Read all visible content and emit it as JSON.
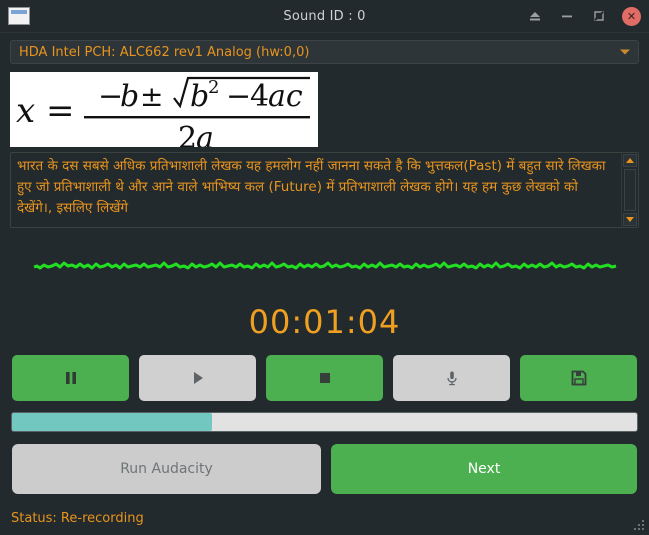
{
  "window": {
    "title": "Sound ID : 0",
    "app_icon": "window-icon",
    "buttons": [
      {
        "name": "shade-button",
        "icon": "eject-icon"
      },
      {
        "name": "minimize-button",
        "icon": "minimize-icon"
      },
      {
        "name": "maximize-button",
        "icon": "restore-icon"
      },
      {
        "name": "close-button",
        "icon": "close-icon",
        "glyph": "✕"
      }
    ]
  },
  "device_combo": {
    "value": "HDA Intel PCH: ALC662 rev1 Analog (hw:0,0)",
    "arrow_icon": "chevron-down-icon"
  },
  "image_panel": {
    "alt": "quadratic-formula-image",
    "formula_numerator": "−b ± √(b² − 4ac)",
    "formula_denominator": "2a",
    "formula_lhs": "x ="
  },
  "text_panel": {
    "content": "भारत के दस सबसे अधिक प्रतिभाशाली लेखक यह हमलोग नहीं जानना सकते है कि भुत्तकल(Past) में बहुत सारे लिखका हुए जो प्रतिभाशाली थे और आने वाले भाभिष्य कल (Future) में प्रतिभाशाली लेखक होगे। यह हम कुछ लेखको को देखेंगे।, इसलिए लिखेंगे",
    "scroll_up_icon": "scroll-up-arrow-icon",
    "scroll_down_icon": "scroll-down-arrow-icon"
  },
  "waveform": {
    "name": "audio-waveform",
    "color": "#22dd22"
  },
  "timer": {
    "value": "00:01:04",
    "color": "#f0a020"
  },
  "transport": [
    {
      "name": "pause-button",
      "icon": "pause-icon",
      "state": "enabled",
      "color": "#4caf50"
    },
    {
      "name": "play-button",
      "icon": "play-icon",
      "state": "disabled",
      "color": "#d0d0d0"
    },
    {
      "name": "stop-button",
      "icon": "stop-icon",
      "state": "enabled",
      "color": "#4caf50"
    },
    {
      "name": "record-button",
      "icon": "microphone-icon",
      "state": "disabled",
      "color": "#d0d0d0"
    },
    {
      "name": "save-button",
      "icon": "floppy-disk-icon",
      "state": "enabled",
      "color": "#4caf50"
    }
  ],
  "progress": {
    "percent": 32,
    "fill_color": "#72c7c0",
    "track_color": "#e2e2e2"
  },
  "bottom_buttons": {
    "run_audacity_label": "Run Audacity",
    "next_label": "Next"
  },
  "status": {
    "text": "Status: Re-recording",
    "color": "#e8941f"
  }
}
